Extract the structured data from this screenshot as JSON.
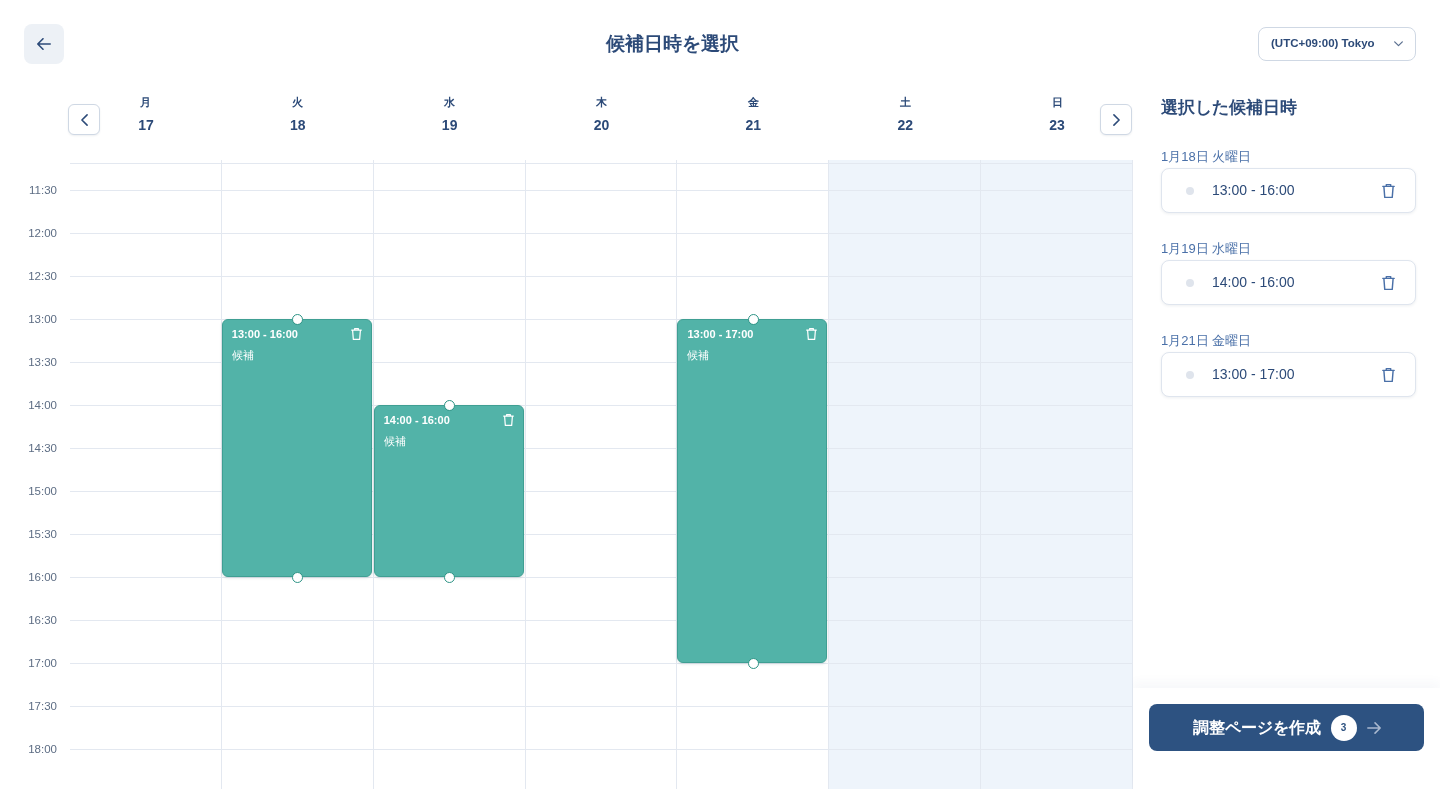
{
  "header": {
    "title": "候補日時を選択",
    "timezone": "(UTC+09:00) Tokyo"
  },
  "calendar": {
    "days": [
      {
        "weekday": "月",
        "date": "17",
        "weekend": false
      },
      {
        "weekday": "火",
        "date": "18",
        "weekend": false,
        "events": [
          {
            "time": "13:00 - 16:00",
            "label": "候補"
          }
        ]
      },
      {
        "weekday": "水",
        "date": "19",
        "weekend": false,
        "events": [
          {
            "time": "14:00 - 16:00",
            "label": "候補"
          }
        ]
      },
      {
        "weekday": "木",
        "date": "20",
        "weekend": false
      },
      {
        "weekday": "金",
        "date": "21",
        "weekend": false,
        "events": [
          {
            "time": "13:00 - 17:00",
            "label": "候補"
          }
        ]
      },
      {
        "weekday": "土",
        "date": "22",
        "weekend": true
      },
      {
        "weekday": "日",
        "date": "23",
        "weekend": true
      }
    ],
    "time_labels": [
      "11:30",
      "12:00",
      "12:30",
      "13:00",
      "13:30",
      "14:00",
      "14:30",
      "15:00",
      "15:30",
      "16:00",
      "16:30",
      "17:00",
      "17:30",
      "18:00"
    ]
  },
  "selected_panel": {
    "title": "選択した候補日時",
    "groups": [
      {
        "date": "1月18日 火曜日",
        "time": "13:00 - 16:00"
      },
      {
        "date": "1月19日 水曜日",
        "time": "14:00 - 16:00"
      },
      {
        "date": "1月21日 金曜日",
        "time": "13:00 - 17:00"
      }
    ]
  },
  "create_button": {
    "label": "調整ページを作成",
    "count": "3"
  }
}
